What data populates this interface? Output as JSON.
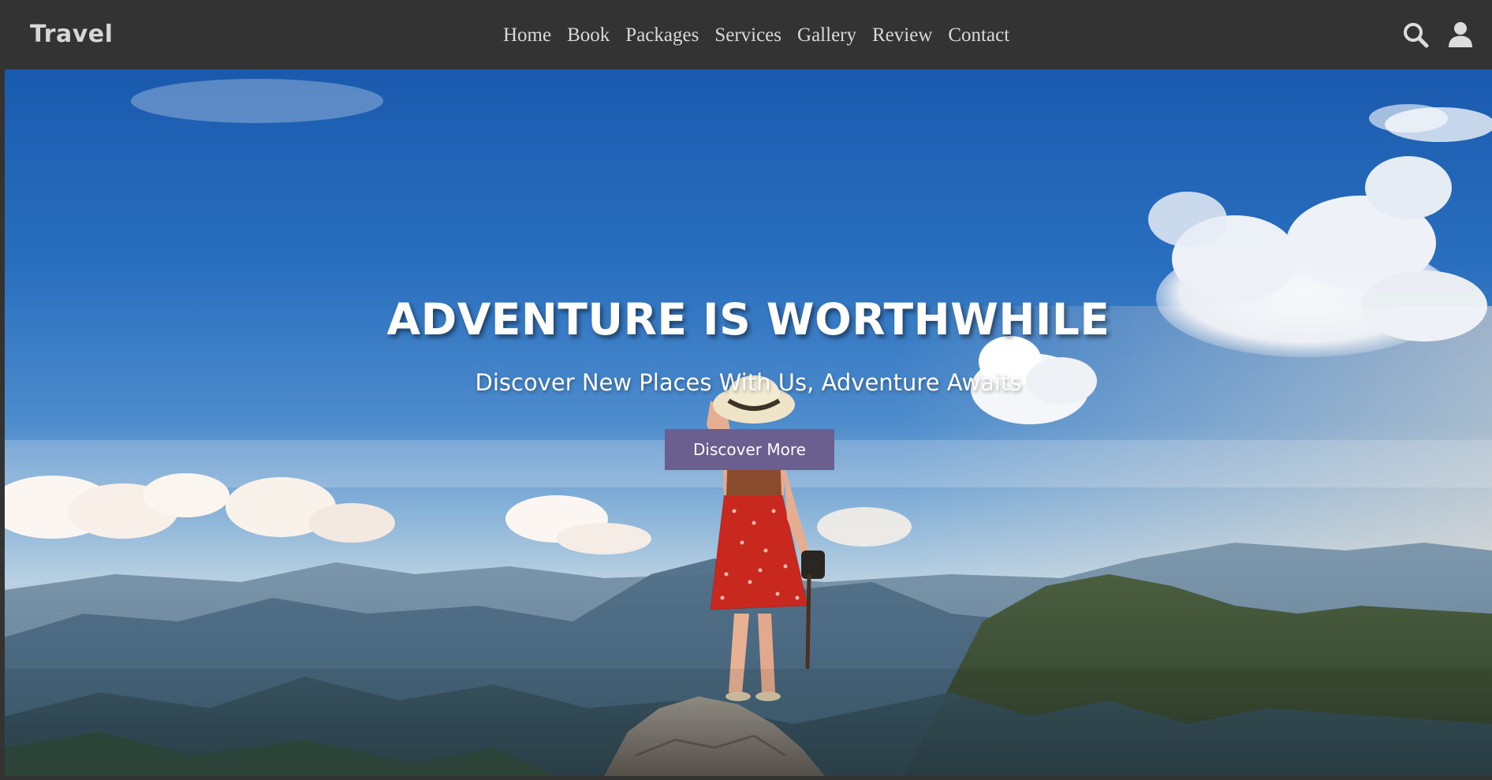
{
  "navbar": {
    "brand": "Travel",
    "links": [
      {
        "label": "Home"
      },
      {
        "label": "Book"
      },
      {
        "label": "Packages"
      },
      {
        "label": "Services"
      },
      {
        "label": "Gallery"
      },
      {
        "label": "Review"
      },
      {
        "label": "Contact"
      }
    ],
    "icons": [
      "search-icon",
      "user-icon"
    ]
  },
  "hero": {
    "title": "ADVENTURE IS WORTHWHILE",
    "subtitle": "Discover New Places With Us, Adventure Awaits",
    "button_label": "Discover More",
    "button_color": "#6a5f8e"
  },
  "colors": {
    "navbar_bg": "#333333",
    "nav_text": "#d9d9d9",
    "sky_top": "#1a5cb0",
    "sky_bottom": "#9cbfd8"
  }
}
